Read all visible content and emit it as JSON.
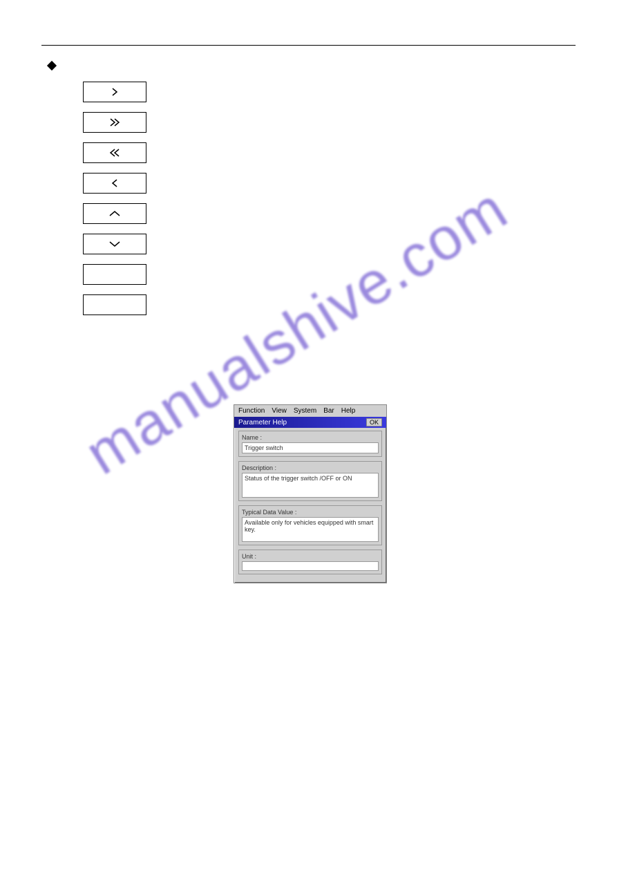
{
  "watermark": "manualshive.com",
  "section_title": "",
  "buttons": {
    "b0": "›",
    "b1": "››",
    "b2": "‹‹",
    "b3": "‹"
  },
  "dialog": {
    "menu": {
      "m0": "Function",
      "m1": "View",
      "m2": "System",
      "m3": "Bar",
      "m4": "Help"
    },
    "title": "Parameter Help",
    "ok": "OK",
    "name_label": "Name :",
    "name_value": "Trigger switch",
    "desc_label": "Description :",
    "desc_value": "Status of the trigger switch /OFF or ON",
    "typical_label": "Typical Data Value :",
    "typical_value": "Available only for vehicles equipped with smart key.",
    "unit_label": "Unit :",
    "unit_value": ""
  }
}
